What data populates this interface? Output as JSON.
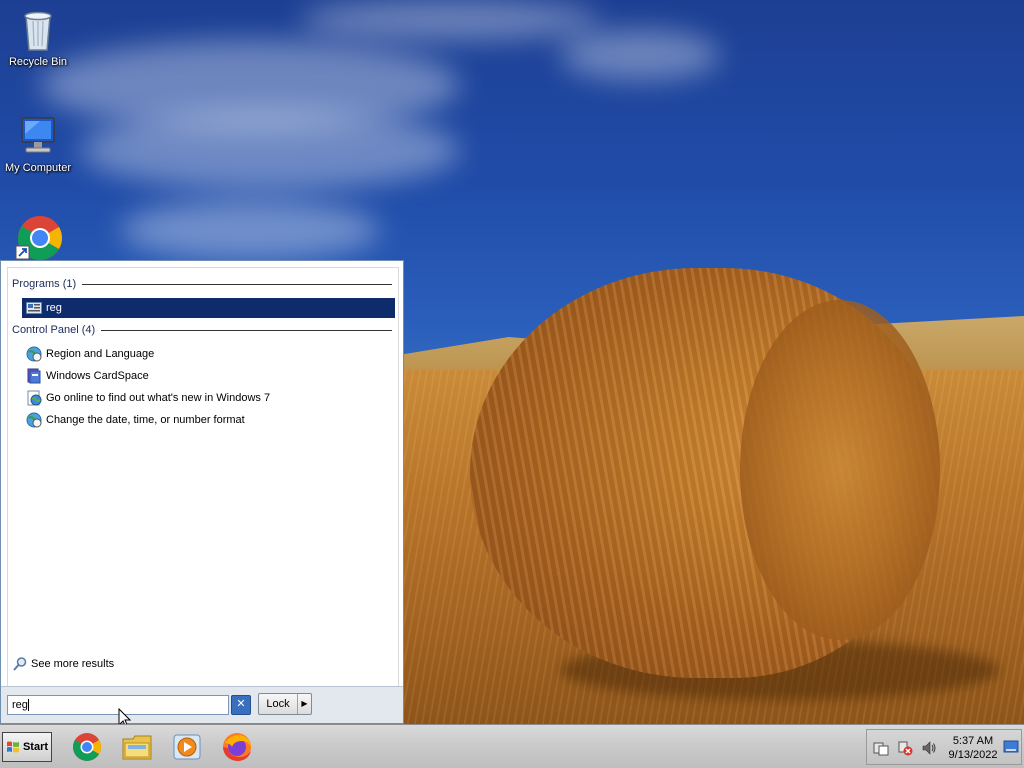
{
  "desktop": {
    "icons": [
      {
        "label": "Recycle Bin",
        "icon": "recycle-bin-icon"
      },
      {
        "label": "My Computer",
        "icon": "computer-icon"
      },
      {
        "label": "",
        "icon": "chrome-shortcut-icon"
      }
    ]
  },
  "start_menu": {
    "groups": [
      {
        "header": "Programs (1)",
        "items": [
          {
            "label": "reg",
            "icon": "registry-editor-icon",
            "selected": true
          }
        ]
      },
      {
        "header": "Control Panel (4)",
        "items": [
          {
            "label": "Region and Language",
            "icon": "globe-clock-icon"
          },
          {
            "label": "Windows CardSpace",
            "icon": "cardspace-icon"
          },
          {
            "label": "Go online to find out what's new in Windows 7",
            "icon": "web-icon"
          },
          {
            "label": "Change the date, time, or number format",
            "icon": "globe-clock-icon"
          }
        ]
      }
    ],
    "see_more": "See more results",
    "search_value": "reg",
    "lock_label": "Lock"
  },
  "taskbar": {
    "start_label": "Start",
    "apps": [
      "chrome-icon",
      "file-explorer-icon",
      "media-player-icon",
      "firefox-icon"
    ],
    "clock_time": "5:37 AM",
    "clock_date": "9/13/2022"
  },
  "colors": {
    "selection": "#0e2c6b",
    "start_menu_border": "#6f8fb0",
    "taskbar": "#c9c9c9"
  }
}
